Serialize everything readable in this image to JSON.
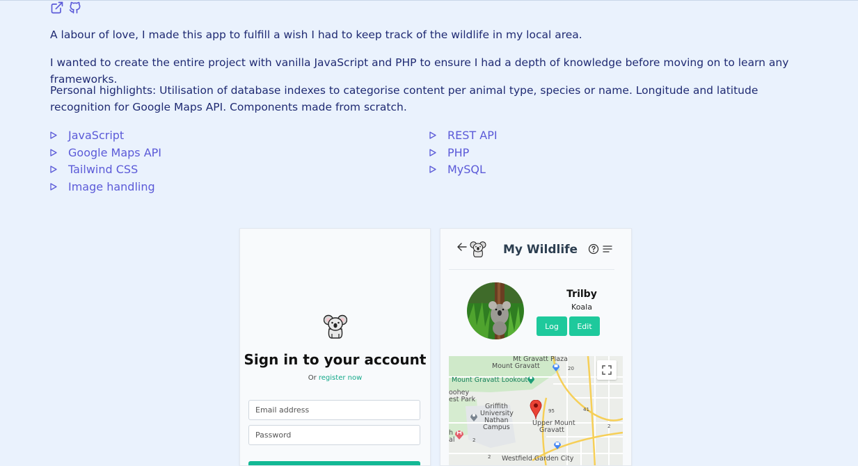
{
  "links": {
    "external_icon": "external-link-icon",
    "github_icon": "github-icon"
  },
  "description": {
    "p1": "A labour of love, I made this app to fulfill a wish I had to keep track of the wildlife in my local area.",
    "p2": "I wanted to create the entire project with vanilla JavaScript and PHP to ensure I had a depth of knowledge before moving on to learn any frameworks.",
    "p3": "Personal highlights: Utilisation of database indexes to categorise content per animal type, species or name. Longitude and latitude recognition for Google Maps API. Components made from scratch."
  },
  "tech": {
    "left": [
      "JavaScript",
      "Google Maps API",
      "Tailwind CSS",
      "Image handling"
    ],
    "right": [
      "REST API",
      "PHP",
      "MySQL"
    ]
  },
  "signin": {
    "title": "Sign in to your account",
    "or_text": "Or",
    "register_link": "register now",
    "email_placeholder": "Email address",
    "password_placeholder": "Password"
  },
  "wildlife": {
    "title": "My Wildlife",
    "name": "Trilby",
    "species": "Koala",
    "log_label": "Log",
    "edit_label": "Edit",
    "map_labels": {
      "l1": "Mt Gravatt Plaza",
      "l2": "Mount Gravatt",
      "l3": "Mount Gravatt Lookout",
      "l4": "oohey",
      "l5": "est Park",
      "l6": "Griffith",
      "l7": "University",
      "l8": "Nathan",
      "l9": "Campus",
      "l10": "Upper Mount",
      "l11": "Gravatt",
      "l12": "Westfield Garden City",
      "l13": "h",
      "l14": "al",
      "r1": "20",
      "r2": "95",
      "r3": "41",
      "r4": "2",
      "r5": "2",
      "r6": "2"
    }
  },
  "colors": {
    "background": "#eaf2fd",
    "text": "#1f2a72",
    "link": "#5b5ad8",
    "accent": "#1ec99c"
  }
}
